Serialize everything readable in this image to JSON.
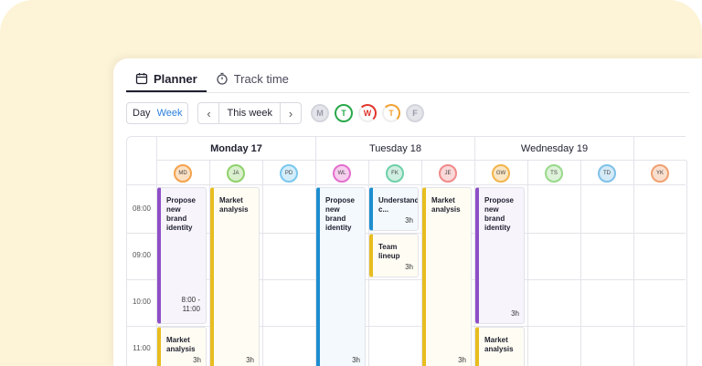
{
  "tabs": [
    {
      "label": "Planner",
      "icon": "calendar-icon"
    },
    {
      "label": "Track time",
      "icon": "stopwatch-icon"
    }
  ],
  "toolbar": {
    "day_label": "Day",
    "week_label": "Week",
    "period_label": "This week",
    "prev_icon": "chevron-left-icon",
    "next_icon": "chevron-right-icon"
  },
  "weekday_filters": [
    {
      "letter": "M",
      "state": "inactive"
    },
    {
      "letter": "T",
      "state": "done",
      "color": "#2aa84a"
    },
    {
      "letter": "W",
      "state": "partial",
      "color": "#e0352b"
    },
    {
      "letter": "T",
      "state": "partial",
      "color": "#f0a030"
    },
    {
      "letter": "F",
      "state": "inactive"
    }
  ],
  "days": [
    {
      "label": "Monday 17",
      "bold": true
    },
    {
      "label": "Tuesday 18",
      "bold": false
    },
    {
      "label": "Wednesday 19",
      "bold": false
    }
  ],
  "people": [
    "MD",
    "JA",
    "PD",
    "WL",
    "FK",
    "JE",
    "GW",
    "TS",
    "TD",
    "YK"
  ],
  "times": [
    "08:00",
    "09:00",
    "10:00",
    "11:00"
  ],
  "events": [
    {
      "title": "Propose new brand identity",
      "range": "8:00 - 11:00",
      "duration": "",
      "accent": "#8e4fc6",
      "bg": "#f7f4fc"
    },
    {
      "title": "Market analysis",
      "range": "",
      "duration": "3h",
      "accent": "#e8bd1f",
      "bg": "#fffdf3"
    },
    {
      "title": "Market analysis",
      "range": "",
      "duration": "3h",
      "accent": "#e8bd1f",
      "bg": "#fffdf3"
    },
    {
      "title": "Propose new brand identity",
      "range": "",
      "duration": "3h",
      "accent": "#1e8ed0",
      "bg": "#f3f9fd"
    },
    {
      "title": "Understanding c...",
      "range": "",
      "duration": "3h",
      "accent": "#1e8ed0",
      "bg": "#f3f9fd"
    },
    {
      "title": "Team lineup",
      "range": "",
      "duration": "3h",
      "accent": "#e8bd1f",
      "bg": "#fffdf3"
    },
    {
      "title": "Market analysis",
      "range": "",
      "duration": "3h",
      "accent": "#e8bd1f",
      "bg": "#fffdf3"
    },
    {
      "title": "Propose new brand identity",
      "range": "",
      "duration": "3h",
      "accent": "#8e4fc6",
      "bg": "#f7f4fc"
    },
    {
      "title": "Market analysis",
      "range": "",
      "duration": "",
      "accent": "#e8bd1f",
      "bg": "#fffdf3"
    }
  ]
}
